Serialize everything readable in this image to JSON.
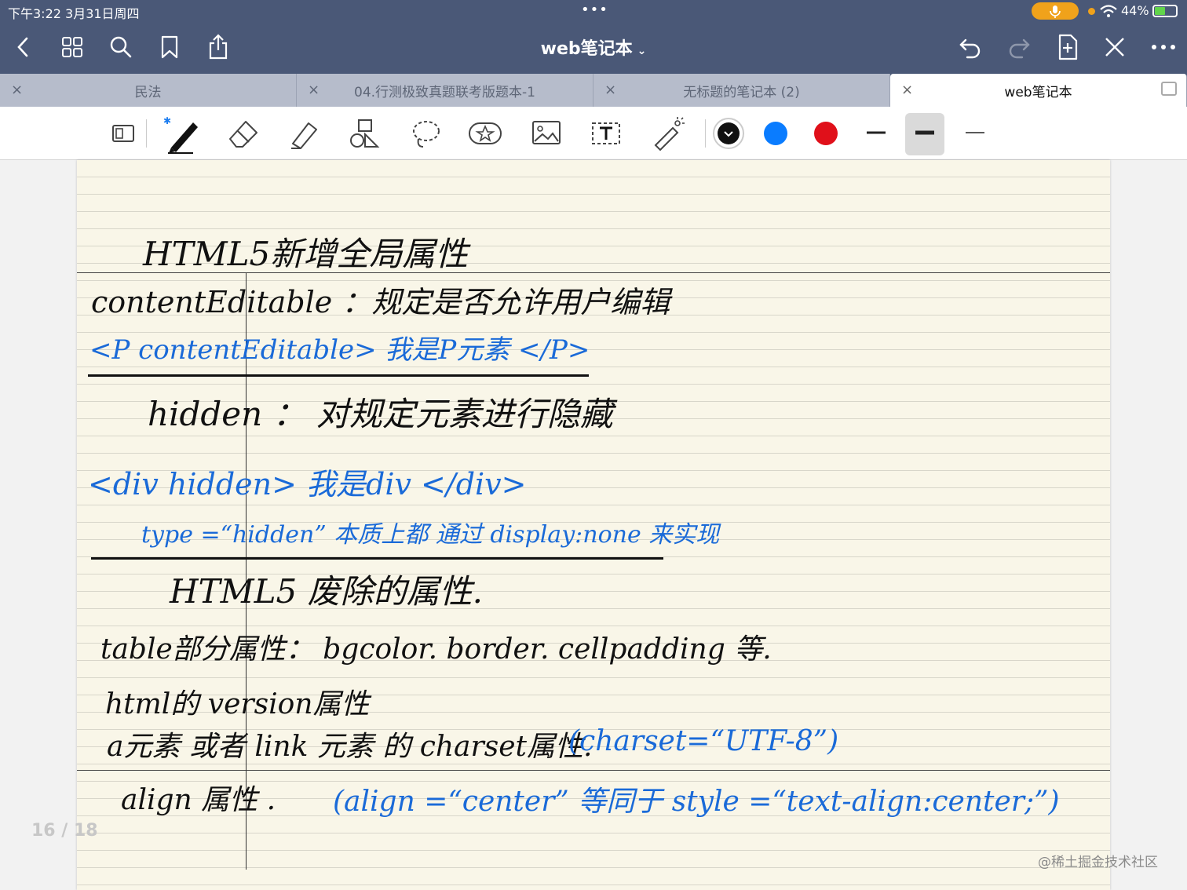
{
  "status": {
    "time": "下午3:22   3月31日周四",
    "dots": "•••",
    "battery": "44%"
  },
  "nav": {
    "title": "web笔记本",
    "title_chevron": "⌄"
  },
  "tabs": [
    {
      "label": "民法"
    },
    {
      "label": "04.行测极致真题联考版题本-1"
    },
    {
      "label": "无标题的笔记本 (2)"
    },
    {
      "label": "web笔记本"
    }
  ],
  "tab_close": "×",
  "colors": {
    "black": "#111111",
    "blue": "#0a7cff",
    "red": "#e0101a"
  },
  "note": {
    "lines": [
      {
        "text": "HTML5新增全局属性",
        "color": "black"
      },
      {
        "text": "contentEditable  ：规定是否允许用户编辑",
        "color": "black"
      },
      {
        "text": "<P   contentEditable> 我是P元素 </P>",
        "color": "blue"
      },
      {
        "text": "hidden   ：  对规定元素进行隐藏",
        "color": "black"
      },
      {
        "text": "<div   hidden> 我是div </div>",
        "color": "blue"
      },
      {
        "text": "type =“hidden” 本质上都 通过 display:none 来实现",
        "color": "blue"
      },
      {
        "text": "HTML5 废除的属性.",
        "color": "black"
      },
      {
        "text": "table部分属性： bgcolor. border. cellpadding 等.",
        "color": "black"
      },
      {
        "text": "html的 version属性",
        "color": "black"
      },
      {
        "text": "a元素 或者 link 元素 的 charset属性.",
        "color": "black"
      },
      {
        "text": "(charset=“UTF-8”)",
        "color": "blue"
      },
      {
        "text": "align 属性 .",
        "color": "black"
      },
      {
        "text": "(align =“center” 等同于 style =“text-align:center;”)",
        "color": "blue"
      }
    ]
  },
  "page_indicator": "16 / 18",
  "watermark": "@稀土掘金技术社区"
}
